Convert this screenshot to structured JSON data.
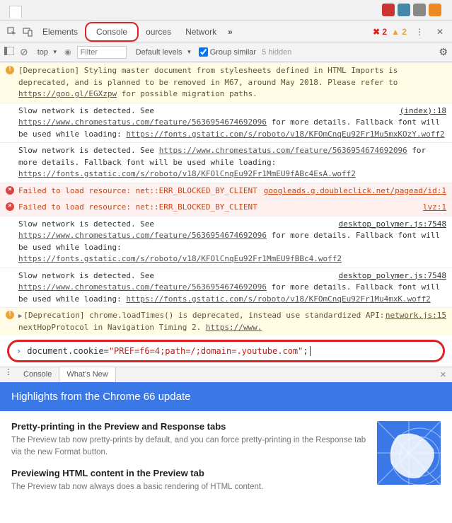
{
  "tabs": {
    "elements": "Elements",
    "console": "Console",
    "sources": "ources",
    "network": "Network"
  },
  "status": {
    "errors": "2",
    "warnings": "2",
    "hidden": "5 hidden"
  },
  "toolbar": {
    "context": "top",
    "filter_placeholder": "Filter",
    "levels": "Default levels",
    "group": "Group similar"
  },
  "msgs": [
    {
      "type": "warn",
      "text_a": "[Deprecation] Styling master document from stylesheets defined in HTML Imports is deprecated, and is planned to be removed in M67, around May 2018. Please refer to ",
      "link_a": "https://goo.gl/EGXzpw",
      "text_b": " for possible migration paths."
    },
    {
      "type": "info",
      "src": "(index):18",
      "text_a": "Slow network is detected. See ",
      "link_a": "https://www.chromestatus.com/feature/5636954674692096",
      "text_b": " for more details. Fallback font will be used while loading: ",
      "link_b": "https://fonts.gstatic.com/s/roboto/v18/KFOmCnqEu92Fr1Mu5mxKOzY.woff2"
    },
    {
      "type": "info",
      "text_a": "Slow network is detected. See ",
      "link_a": "https://www.chromestatus.com/feature/5636954674692096",
      "text_b": " for more details. Fallback font will be used while loading: ",
      "link_b": "https://fonts.gstatic.com/s/roboto/v18/KFOlCnqEu92Fr1MmEU9fABc4EsA.woff2"
    },
    {
      "type": "err",
      "src": "googleads.g.doubleclick.net/pagead/id:1",
      "text_a": "Failed to load resource: net::ERR_BLOCKED_BY_CLIENT"
    },
    {
      "type": "err",
      "src": "lvz:1",
      "text_a": "Failed to load resource: net::ERR_BLOCKED_BY_CLIENT"
    },
    {
      "type": "info",
      "src": "desktop_polymer.js:7548",
      "text_a": "Slow network is detected. See ",
      "link_a": "https://www.chromestatus.com/feature/5636954674692096",
      "text_b": " for more details. Fallback font will be used while loading: ",
      "link_b": "https://fonts.gstatic.com/s/roboto/v18/KFOlCnqEu92Fr1MmEU9fBBc4.woff2"
    },
    {
      "type": "info",
      "src": "desktop_polymer.js:7548",
      "text_a": "Slow network is detected. See ",
      "link_a": "https://www.chromestatus.com/feature/5636954674692096",
      "text_b": " for more details. Fallback font will be used while loading: ",
      "link_b": "https://fonts.gstatic.com/s/roboto/v18/KFOmCnqEu92Fr1Mu4mxK.woff2"
    },
    {
      "type": "warn",
      "src": "network.js:15",
      "tri": true,
      "text_a": "[Deprecation] chrome.loadTimes() is deprecated, instead use standardized API: nextHopProtocol in Navigation Timing 2. ",
      "link_a": "https://www."
    }
  ],
  "input": {
    "pre": "document.cookie=",
    "str": "\"PREF=f6=4;path=/;domain=.youtube.com\"",
    "post": ";"
  },
  "drawer": {
    "console": "Console",
    "whatsnew": "What's New"
  },
  "update": {
    "title": "Highlights from the Chrome 66 update",
    "h1": "Pretty-printing in the Preview and Response tabs",
    "p1": "The Preview tab now pretty-prints by default, and you can force pretty-printing in the Response tab via the new Format button.",
    "h2": "Previewing HTML content in the Preview tab",
    "p2": "The Preview tab now always does a basic rendering of HTML content."
  }
}
